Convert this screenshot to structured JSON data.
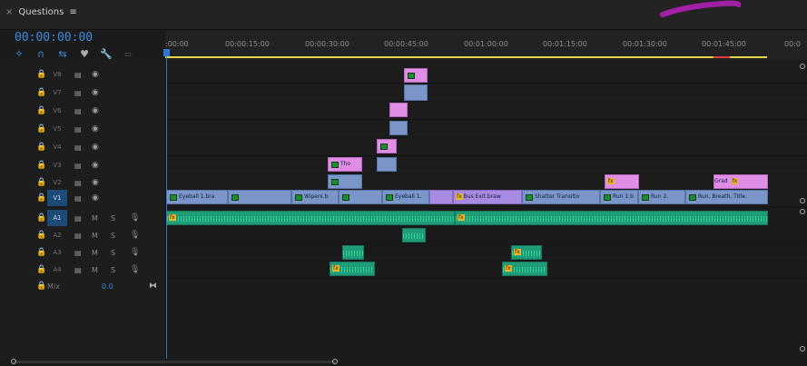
{
  "panel": {
    "close_glyph": "×",
    "title": "Questions",
    "menu_glyph": "≡"
  },
  "timecode": "00:00:00:00",
  "tools": [
    "snap-icon",
    "link-icon",
    "linked-selection-icon",
    "marker-icon",
    "wrench-icon",
    "captions-icon"
  ],
  "ruler": {
    "ticks": [
      ":00:00",
      "00:00:15:00",
      "00:00:30:00",
      "00:00:45:00",
      "00:01:00:00",
      "00:01:15:00",
      "00:01:30:00",
      "00:01:45:00",
      "00:0"
    ]
  },
  "tracks": {
    "video": [
      {
        "name": "V8",
        "lock": "🔒",
        "sync": "▤",
        "eye": "◉"
      },
      {
        "name": "V7",
        "lock": "🔒",
        "sync": "▤",
        "eye": "◉"
      },
      {
        "name": "V6",
        "lock": "🔒",
        "sync": "▤",
        "eye": "◉"
      },
      {
        "name": "V5",
        "lock": "🔒",
        "sync": "▤",
        "eye": "◉"
      },
      {
        "name": "V4",
        "lock": "🔒",
        "sync": "▤",
        "eye": "◉"
      },
      {
        "name": "V3",
        "lock": "🔒",
        "sync": "▤",
        "eye": "◉"
      },
      {
        "name": "V2",
        "lock": "🔒",
        "sync": "▤",
        "eye": "◉"
      },
      {
        "name": "V1",
        "lock": "🔒",
        "sync": "▤",
        "eye": "◉"
      }
    ],
    "audio": [
      {
        "name": "A1",
        "lock": "🔒",
        "sync": "▤",
        "m": "M",
        "s": "S",
        "mic": "🎙"
      },
      {
        "name": "A2",
        "lock": "🔒",
        "sync": "▤",
        "m": "M",
        "s": "S",
        "mic": "🎙"
      },
      {
        "name": "A3",
        "lock": "🔒",
        "sync": "▤",
        "m": "M",
        "s": "S",
        "mic": "🎙"
      },
      {
        "name": "A4",
        "lock": "🔒",
        "sync": "▤",
        "m": "M",
        "s": "S",
        "mic": "🎙"
      }
    ],
    "mix": {
      "lock": "🔒",
      "label": "Mix",
      "value": "0.0",
      "bowtie": "⧓"
    }
  },
  "clips": {
    "v1": [
      "Eyeball 1.bra",
      "Wipers.b",
      "Eyeball 1.",
      "Bus Exit.braw",
      "Shatter Transitio",
      "Run 1.b",
      "Run 2.",
      "Run, Breath, Title."
    ],
    "v2_tho": "Tho",
    "fx": "fx",
    "grad": "Grad"
  },
  "colors": {
    "accent": "#3e8ae0",
    "video": "#7a95c8",
    "graphics": "#e08de6",
    "audio": "#1f9b78",
    "work_area": "#e3d44a"
  }
}
